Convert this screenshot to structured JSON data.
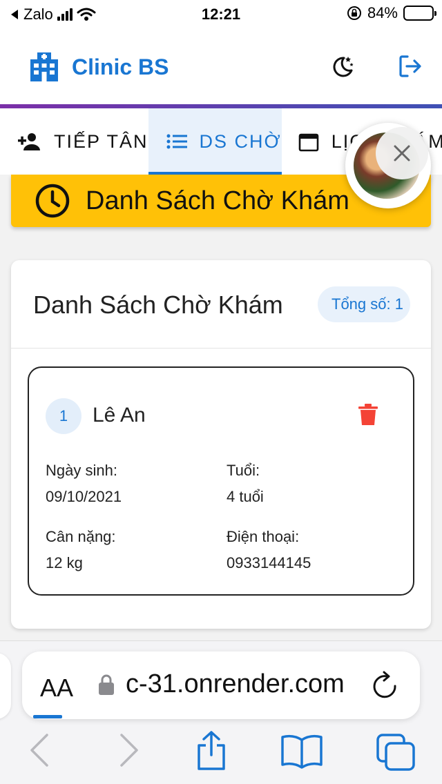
{
  "status_bar": {
    "back_app": "Zalo",
    "time": "12:21",
    "battery_percent": "84%",
    "battery_level": 0.84
  },
  "header": {
    "app_title": "Clinic BS",
    "theme_toggle_icon": "moon-stars-icon",
    "logout_icon": "logout-icon",
    "brand_color": "#1976d2"
  },
  "tabs": [
    {
      "label": "TIẾP TÂN",
      "icon": "person-add-icon",
      "active": false
    },
    {
      "label": "DS CHỜ",
      "icon": "list-icon",
      "active": true
    },
    {
      "label": "LỊCH KHÁM",
      "icon": "calendar-icon",
      "active": false
    }
  ],
  "banner": {
    "title": "Danh Sách Chờ Khám",
    "icon": "clock-icon",
    "color": "#ffc107"
  },
  "waiting_list": {
    "title": "Danh Sách Chờ Khám",
    "total_label": "Tổng số: 1",
    "patients": [
      {
        "number": "1",
        "name": "Lê An",
        "dob_label": "Ngày sinh:",
        "dob": "09/10/2021",
        "age_label": "Tuổi:",
        "age": "4 tuổi",
        "weight_label": "Cân nặng:",
        "weight": "12 kg",
        "phone_label": "Điện thoại:",
        "phone": "0933144145"
      }
    ]
  },
  "floating_bubble": {
    "close_icon": "close-icon"
  },
  "browser": {
    "text_size_label": "AA",
    "url": "c-31.onrender.com",
    "lock_icon": "lock-icon",
    "reload_icon": "reload-icon",
    "toolbar_icons": [
      "back-icon",
      "forward-icon",
      "share-icon",
      "bookmarks-icon",
      "tabs-icon"
    ]
  }
}
